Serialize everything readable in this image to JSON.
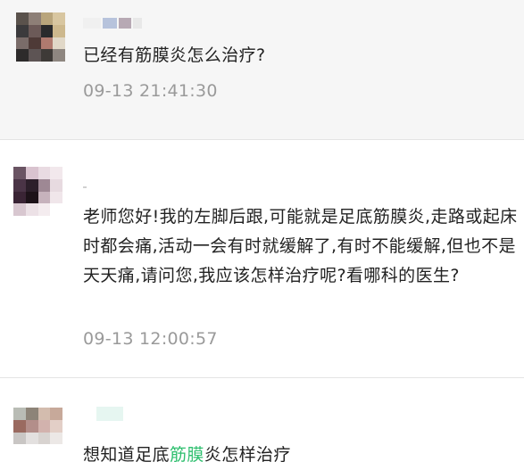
{
  "comments": [
    {
      "text": "已经有筋膜炎怎么治疗?",
      "time": "09-13 21:41:30"
    },
    {
      "text": "老师您好!我的左脚后跟,可能就是足底筋膜炎,走路或起床时都会痛,活动一会有时就缓解了,有时不能缓解,但也不是天天痛,请问您,我应该怎样治疗呢?看哪科的医生?",
      "time": "09-13 12:00:57"
    },
    {
      "text_before": "想知道足底",
      "text_highlight": "筋膜",
      "text_after": "炎怎样治疗"
    }
  ],
  "colors": {
    "accent": "#2fbf6f",
    "timestamp": "#9a9a9a",
    "text": "#222222"
  }
}
